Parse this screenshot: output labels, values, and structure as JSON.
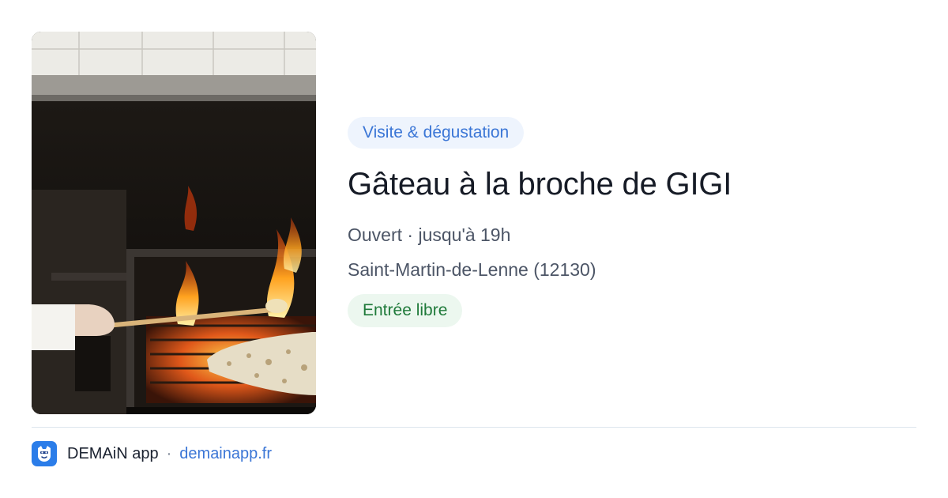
{
  "listing": {
    "category_tag": "Visite & dégustation",
    "title": "Gâteau à la broche de GIGI",
    "status": "Ouvert · jusqu'à 19h",
    "address": "Saint-Martin-de-Lenne (12130)",
    "entry_badge": "Entrée libre"
  },
  "footer": {
    "app_name": "DEMAiN app",
    "separator": "·",
    "domain": "demainapp.fr",
    "icon": "demain-app-logo-icon"
  },
  "colors": {
    "tag_bg": "#eef4fd",
    "tag_text": "#3b76d6",
    "entry_bg": "#ecf7ef",
    "entry_text": "#1f7a3a",
    "link": "#3b76d6",
    "title": "#161b26"
  }
}
